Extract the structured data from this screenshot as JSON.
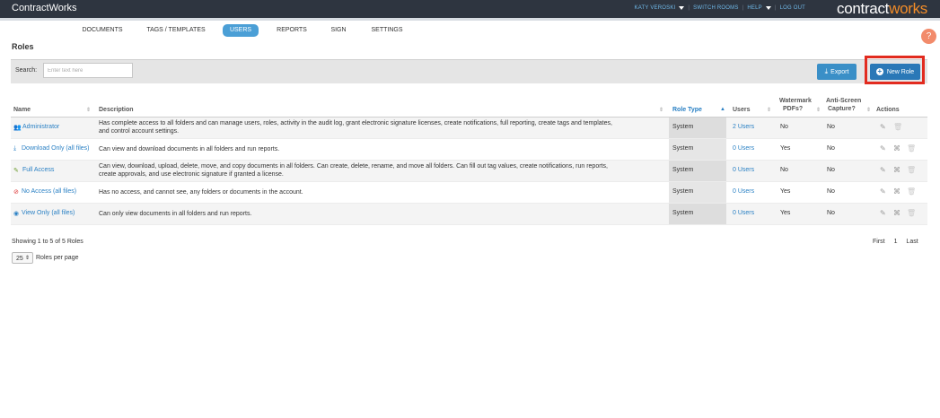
{
  "app": {
    "name": "ContractWorks",
    "logo_main": "contract",
    "logo_accent": "works",
    "user_name": "KATY VEROSKI",
    "switch_rooms": "SWITCH ROOMS",
    "help": "HELP",
    "logout": "LOG OUT",
    "help_badge": "?"
  },
  "nav": {
    "tabs": [
      {
        "label": "DOCUMENTS"
      },
      {
        "label": "TAGS / TEMPLATES"
      },
      {
        "label": "USERS"
      },
      {
        "label": "REPORTS"
      },
      {
        "label": "SIGN"
      },
      {
        "label": "SETTINGS"
      }
    ],
    "active": "USERS"
  },
  "page": {
    "title": "Roles"
  },
  "toolbar": {
    "search_label": "Search:",
    "search_placeholder": "Enter text here",
    "search_value": "",
    "export_label": "Export",
    "new_role_label": "New Role"
  },
  "table": {
    "columns": {
      "name": "Name",
      "description": "Description",
      "role_type": "Role Type",
      "users": "Users",
      "watermark_1": "Watermark",
      "watermark_2": "PDFs?",
      "anti_1": "Anti-Screen",
      "anti_2": "Capture?",
      "actions": "Actions"
    },
    "rows": [
      {
        "icon": "users-icon",
        "name": "Administrator",
        "desc_1": "Has complete access to all folders and can manage users, roles, activity in the audit log, grant electronic signature licenses, create notifications, full reporting, create tags and templates,",
        "desc_2": "and control account settings.",
        "role_type": "System",
        "users": "2 Users",
        "watermark": "No",
        "anti_capture": "No"
      },
      {
        "icon": "download-icon",
        "name": "Download Only (all files)",
        "desc_1": "Can view and download documents in all folders and run reports.",
        "desc_2": "",
        "role_type": "System",
        "users": "0 Users",
        "watermark": "Yes",
        "anti_capture": "No"
      },
      {
        "icon": "edit-icon",
        "name": "Full Access",
        "desc_1": "Can view, download, upload, delete, move, and copy documents in all folders. Can create, delete, rename, and move all folders. Can fill out tag values, create notifications, run reports,",
        "desc_2": "create approvals, and use electronic signature if granted a license.",
        "role_type": "System",
        "users": "0 Users",
        "watermark": "No",
        "anti_capture": "No"
      },
      {
        "icon": "ban-icon",
        "name": "No Access (all files)",
        "desc_1": "Has no access, and cannot see, any folders or documents in the account.",
        "desc_2": "",
        "role_type": "System",
        "users": "0 Users",
        "watermark": "Yes",
        "anti_capture": "No"
      },
      {
        "icon": "eye-icon",
        "name": "View Only (all files)",
        "desc_1": "Can only view documents in all folders and run reports.",
        "desc_2": "",
        "role_type": "System",
        "users": "0 Users",
        "watermark": "Yes",
        "anti_capture": "No"
      }
    ]
  },
  "footer": {
    "showing": "Showing 1 to 5 of 5 Roles",
    "first": "First",
    "page": "1",
    "last": "Last",
    "per_page_value": "25",
    "per_page_label": "Roles per page"
  }
}
